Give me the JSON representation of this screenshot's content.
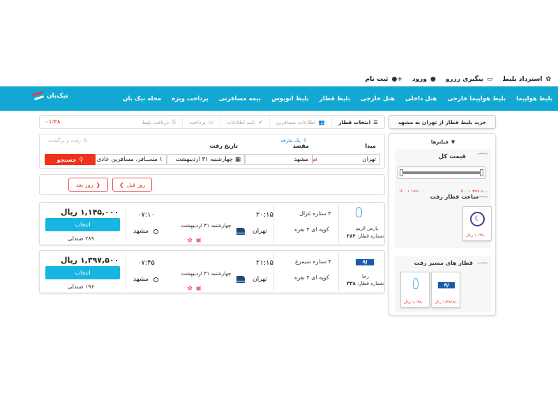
{
  "topbar": {
    "refund": "استرداد بلیط",
    "track": "پیگیری رزرو",
    "login": "ورود",
    "signup": "ثبت نام"
  },
  "nav": {
    "items": [
      "بلیط هواپیما",
      "بلیط هواپیما خارجی",
      "هتل داخلی",
      "هتل خارجی",
      "بلیط قطار",
      "بلیط اتوبوس",
      "بیمه مسافرتی",
      "پرداخت ویژه",
      "مجله تیک بان"
    ],
    "logo_text": "تیک‌بان"
  },
  "sidebar": {
    "title": "خرید بلیط قطار از تهران به مشهد",
    "filters_label": "فیلترها",
    "total_price_label": "قیمت کل",
    "tiny_label": "برچسبی",
    "price_min": "۱,۱۴۵,۰۰۰ ریال",
    "price_max": "۱,۳۹۷,۵۰۰ ریال",
    "price_range": 1.0,
    "departure_time_label": "ساعت قطار رفت",
    "departure_time_price": "۱,۱۴۵,۰۰۰ ریال",
    "route_trains_label": "قطار های مسیر رفت",
    "route_prices": [
      "۱,۳۹۷,۵۰۰ ریال",
      "۱,۱۴۵,۰۰۰ ریال"
    ]
  },
  "steps": {
    "items": [
      "انتخاب قطار",
      "اطلاعات مسافرین",
      "تایید اطلاعات",
      "پرداخت",
      "دریافت بلیط"
    ],
    "timer": "۰۱:۳۸"
  },
  "search": {
    "origin_label": "مبدا",
    "origin_value": "تهران",
    "dest_label": "مقصد",
    "dest_value": "مشهد",
    "date_label": "تاریخ رفت",
    "date_value": "چهارشنبه ۳۱ اردیبهشت",
    "passengers_value": "۱ مســافر، مسافرین عادی",
    "oneway": "یک طرفه",
    "roundtrip": "رفت و برگشت",
    "search_button": "جستجو"
  },
  "daynav": {
    "prev": "روز قبل",
    "next": "روز بعد"
  },
  "results": [
    {
      "price": "۱,۱۴۵,۰۰۰ ریال",
      "select": "انتخاب",
      "seats": "۲۸۹ صندلی",
      "arrival_time": "۰۷:۱۰",
      "arrival_city": "مشهد",
      "departure_time": "۲۰:۱۵",
      "departure_city": "تهران",
      "date": "چهارشنبه ۳۱ اردیبهشت",
      "train_name": "۴ ستاره غزال",
      "compartment": "کوپه ای ۴ نفره",
      "company": "پارس لاریم",
      "train_number_label": "شماره قطار:",
      "train_number": "۳۸۴"
    },
    {
      "price": "۱,۳۹۷,۵۰۰ ریال",
      "select": "انتخاب",
      "seats": "۱۹۶ صندلی",
      "arrival_time": "۰۷:۴۵",
      "arrival_city": "مشهد",
      "departure_time": "۲۱:۱۵",
      "departure_city": "تهران",
      "date": "چهارشنبه ۳۱ اردیبهشت",
      "train_name": "۴ ستاره سیمرغ",
      "compartment": "کوپه ای ۴ نفره",
      "company": "رجا",
      "train_number_label": "شماره قطار:",
      "train_number": "۳۳۸"
    }
  ],
  "colors": {
    "nav_bg": "#13a8d3",
    "select_btn": "#18b5e3",
    "search_btn": "#f0311b",
    "day_btn_border": "#e55555"
  }
}
